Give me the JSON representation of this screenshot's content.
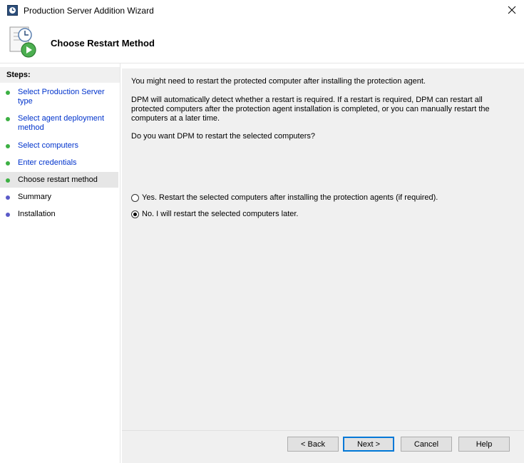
{
  "window": {
    "title": "Production Server Addition Wizard",
    "close_icon": "close-icon"
  },
  "header": {
    "title": "Choose Restart Method",
    "icon": "clock-document-play-icon"
  },
  "steps": {
    "heading": "Steps:",
    "items": [
      {
        "label": "Select Production Server type",
        "state": "done"
      },
      {
        "label": "Select agent deployment method",
        "state": "done"
      },
      {
        "label": "Select computers",
        "state": "done"
      },
      {
        "label": "Enter credentials",
        "state": "done"
      },
      {
        "label": "Choose restart method",
        "state": "current"
      },
      {
        "label": "Summary",
        "state": "pending"
      },
      {
        "label": "Installation",
        "state": "pending"
      }
    ],
    "colors": {
      "done": "#3cb043",
      "current": "#3cb043",
      "pending": "#5b5bc8"
    }
  },
  "main": {
    "intro": "You might need to restart the protected computer after installing the protection agent.",
    "detail": "DPM will automatically detect whether a restart is required. If a restart is required, DPM can restart all protected computers after the protection agent installation is completed, or you can manually restart the computers at a later time.",
    "question": "Do you want DPM to restart the selected computers?",
    "options": [
      {
        "label": "Yes. Restart the selected computers after installing the protection agents (if required).",
        "selected": false
      },
      {
        "label": "No. I will restart the selected computers later.",
        "selected": true
      }
    ]
  },
  "buttons": {
    "back": "< Back",
    "next": "Next >",
    "cancel": "Cancel",
    "help": "Help"
  }
}
